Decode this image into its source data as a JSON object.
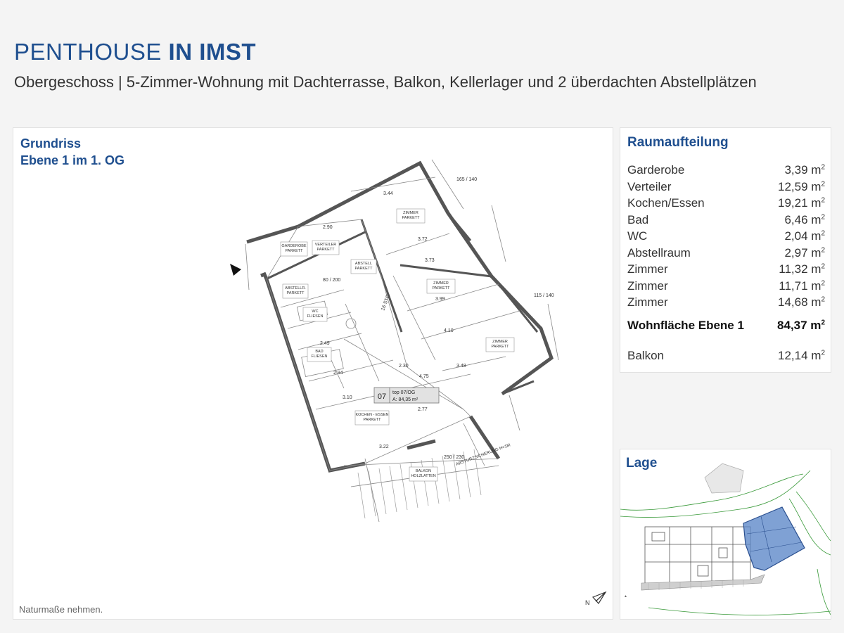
{
  "header": {
    "title_light": "PENTHOUSE",
    "title_bold": "IN IMST",
    "subtitle": "Obergeschoss | 5-Zimmer-Wohnung mit Dachterrasse, Balkon, Kellerlager und 2 überdachten Abstellplätzen"
  },
  "plan": {
    "title_line1": "Grundriss",
    "title_line2": "Ebene 1 im 1. OG",
    "note": "Naturmaße nehmen.",
    "labels": {
      "garderobe": "GARDEROBE",
      "verteiler": "VERTEILER",
      "abstellr": "ABSTELLR.",
      "wc": "WC",
      "bad": "BAD",
      "abstell": "ABSTELL",
      "zimmer": "ZIMMER",
      "kochen": "KOCHEN - ESSEN",
      "balkon": "BALKON",
      "parkett": "PARKETT",
      "fliesen": "FLIESEN",
      "holzlatten": "HOLZLATTEN",
      "top_number": "07",
      "top_label": "top 07/OG",
      "top_area": "A: 84,35 m²",
      "stg": "16 STG",
      "absturz": "ABSTURZSICHERUNG  H=1M",
      "dim_1": "3.44",
      "dim_2": "3.72",
      "dim_3": "3.73",
      "dim_4": "3.99",
      "dim_5": "4.10",
      "dim_6": "2.30",
      "dim_7": "4.75",
      "dim_8": "3.22",
      "dim_9": "3.10",
      "dim_10": "2.94",
      "dim_11": "2.77",
      "dim_12": "80 / 200",
      "dim_13": "165 / 140",
      "dim_14": "115 / 140",
      "dim_15": "250 / 230",
      "dim_16": "2.90",
      "dim_17": "2.49",
      "dim_18": "3.48"
    },
    "north_label": "N"
  },
  "rooms": {
    "title": "Raumaufteilung",
    "items": [
      {
        "name": "Garderobe",
        "area": "3,39 m"
      },
      {
        "name": "Verteiler",
        "area": "12,59 m"
      },
      {
        "name": "Kochen/Essen",
        "area": "19,21 m"
      },
      {
        "name": "Bad",
        "area": "6,46 m"
      },
      {
        "name": "WC",
        "area": "2,04 m"
      },
      {
        "name": "Abstellraum",
        "area": "2,97 m"
      },
      {
        "name": "Zimmer",
        "area": "11,32 m"
      },
      {
        "name": "Zimmer",
        "area": "11,71 m"
      },
      {
        "name": "Zimmer",
        "area": "14,68 m"
      }
    ],
    "total": {
      "name": "Wohnfläche Ebene 1",
      "area": "84,37 m"
    },
    "balkon": {
      "name": "Balkon",
      "area": "12,14 m"
    },
    "unit_sup": "2"
  },
  "lage": {
    "title": "Lage"
  }
}
